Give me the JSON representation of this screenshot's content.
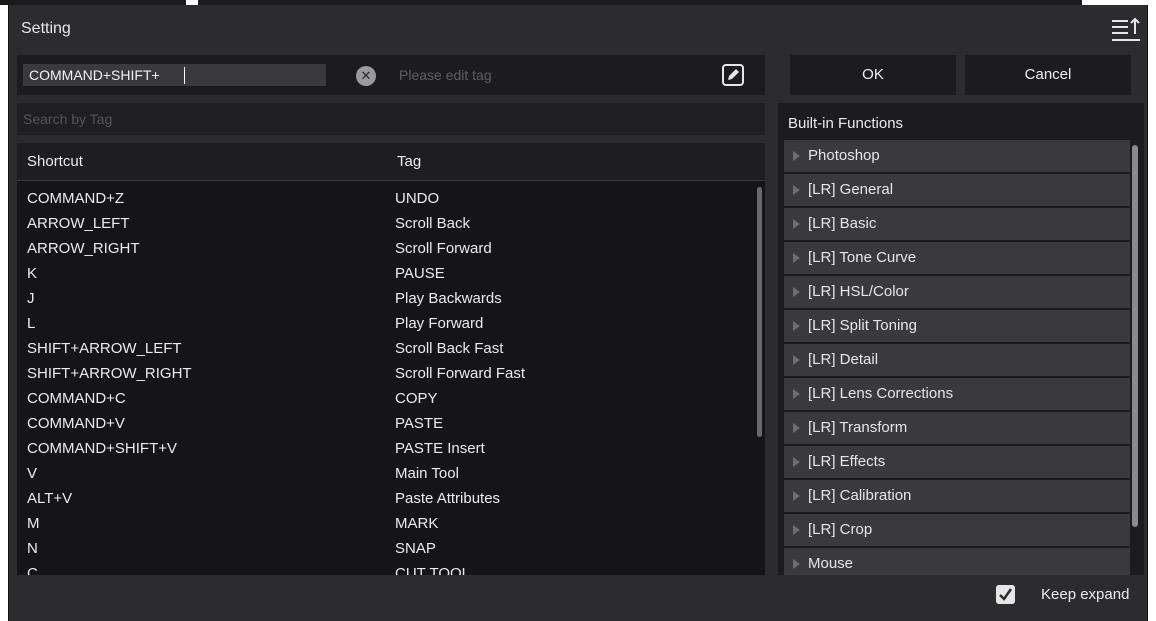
{
  "window": {
    "title": "Setting"
  },
  "editor": {
    "shortcut_value": "COMMAND+SHIFT+",
    "tag_placeholder": "Please edit tag"
  },
  "buttons": {
    "ok": "OK",
    "cancel": "Cancel"
  },
  "search": {
    "placeholder": "Search by Tag"
  },
  "table": {
    "headers": {
      "shortcut": "Shortcut",
      "tag": "Tag"
    },
    "rows": [
      {
        "shortcut": "COMMAND+Z",
        "tag": "UNDO"
      },
      {
        "shortcut": "ARROW_LEFT",
        "tag": "Scroll Back"
      },
      {
        "shortcut": "ARROW_RIGHT",
        "tag": "Scroll Forward"
      },
      {
        "shortcut": "K",
        "tag": "PAUSE"
      },
      {
        "shortcut": "J",
        "tag": "Play Backwards"
      },
      {
        "shortcut": "L",
        "tag": "Play Forward"
      },
      {
        "shortcut": "SHIFT+ARROW_LEFT",
        "tag": "Scroll Back Fast"
      },
      {
        "shortcut": "SHIFT+ARROW_RIGHT",
        "tag": "Scroll Forward Fast"
      },
      {
        "shortcut": "COMMAND+C",
        "tag": "COPY"
      },
      {
        "shortcut": "COMMAND+V",
        "tag": "PASTE"
      },
      {
        "shortcut": "COMMAND+SHIFT+V",
        "tag": "PASTE Insert"
      },
      {
        "shortcut": "V",
        "tag": "Main Tool"
      },
      {
        "shortcut": "ALT+V",
        "tag": "Paste Attributes"
      },
      {
        "shortcut": "M",
        "tag": "MARK"
      },
      {
        "shortcut": "N",
        "tag": "SNAP"
      },
      {
        "shortcut": "C",
        "tag": "CUT TOOL"
      }
    ]
  },
  "functions": {
    "title": "Built-in Functions",
    "items": [
      "Photoshop",
      "[LR] General",
      "[LR] Basic",
      "[LR] Tone Curve",
      "[LR] HSL/Color",
      "[LR] Split Toning",
      "[LR] Detail",
      "[LR] Lens Corrections",
      "[LR] Transform",
      "[LR] Effects",
      "[LR] Calibration",
      "[LR] Crop",
      "Mouse"
    ]
  },
  "footer": {
    "keep_expand_label": "Keep expand",
    "keep_expand_checked": true
  },
  "icons": {
    "sort": "sort-icon",
    "clear": "clear-icon",
    "edit": "edit-icon",
    "expand": "disclosure-triangle-icon"
  },
  "colors": {
    "window_bg": "#2c2c2e",
    "field_bg": "#1c1c1e",
    "list_item_bg": "#3a3a3c",
    "text": "#ececec"
  }
}
